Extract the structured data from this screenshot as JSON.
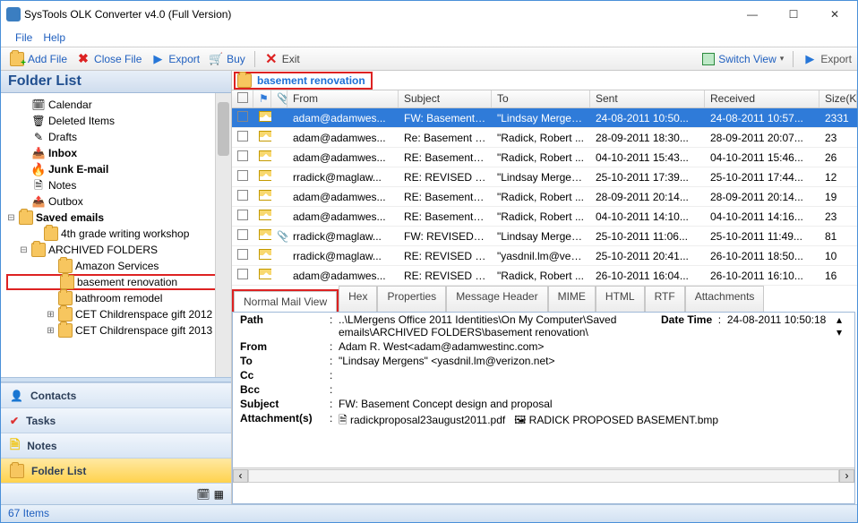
{
  "title": {
    "text": "SysTools OLK Converter v4.0 (Full Version)"
  },
  "winbuttons": {
    "minimize": "—",
    "maximize": "☐",
    "close": "✕"
  },
  "menubar": {
    "file": "File",
    "help": "Help"
  },
  "toolbar": {
    "add_file": "Add File",
    "close_file": "Close File",
    "export": "Export",
    "buy": "Buy",
    "exit": "Exit",
    "switch_view": "Switch View",
    "export2": "Export"
  },
  "left": {
    "header": "Folder List",
    "items": [
      {
        "label": "Calendar",
        "ind": 1,
        "icon": "cal"
      },
      {
        "label": "Deleted Items",
        "ind": 1,
        "icon": "trash"
      },
      {
        "label": "Drafts",
        "ind": 1,
        "icon": "draft"
      },
      {
        "label": "Inbox",
        "ind": 1,
        "icon": "inbox",
        "bold": true
      },
      {
        "label": "Junk E-mail",
        "ind": 1,
        "icon": "junk",
        "bold": true
      },
      {
        "label": "Notes",
        "ind": 1,
        "icon": "note"
      },
      {
        "label": "Outbox",
        "ind": 1,
        "icon": "out"
      },
      {
        "label": "Saved emails",
        "ind": 0,
        "icon": "folder",
        "bold": true,
        "exp": "−"
      },
      {
        "label": "4th grade writing workshop",
        "ind": 2,
        "icon": "folder"
      },
      {
        "label": "ARCHIVED FOLDERS",
        "ind": 1,
        "icon": "folder",
        "exp": "−"
      },
      {
        "label": "Amazon Services",
        "ind": 3,
        "icon": "folder"
      },
      {
        "label": "basement renovation",
        "ind": 3,
        "icon": "folder",
        "selected": true
      },
      {
        "label": "bathroom remodel",
        "ind": 3,
        "icon": "folder"
      },
      {
        "label": "CET Childrenspace gift 2012",
        "ind": 3,
        "icon": "folder",
        "exp": "+"
      },
      {
        "label": "CET Childrenspace gift 2013",
        "ind": 3,
        "icon": "folder",
        "exp": "+"
      }
    ],
    "nav": {
      "contacts": "Contacts",
      "tasks": "Tasks",
      "notes": "Notes",
      "folder": "Folder List"
    }
  },
  "right": {
    "heading": "basement renovation",
    "columns": {
      "from": "From",
      "subject": "Subject",
      "to": "To",
      "sent": "Sent",
      "received": "Received",
      "size": "Size(KB)"
    },
    "rows": [
      {
        "sel": true,
        "clip": false,
        "from": "adam@adamwes...",
        "subject": "FW: Basement C...",
        "to": "\"Lindsay Mergen...",
        "sent": "24-08-2011 10:50...",
        "received": "24-08-2011 10:57...",
        "size": "2331"
      },
      {
        "from": "adam@adamwes...",
        "subject": "Re: Basement Co...",
        "to": "\"Radick, Robert ...",
        "sent": "28-09-2011 18:30...",
        "received": "28-09-2011 20:07...",
        "size": "23"
      },
      {
        "from": "adam@adamwes...",
        "subject": "RE: Basement Co...",
        "to": "\"Radick, Robert ...",
        "sent": "04-10-2011 15:43...",
        "received": "04-10-2011 15:46...",
        "size": "26"
      },
      {
        "from": "rradick@maglaw...",
        "subject": "RE: REVISED PR...",
        "to": "\"Lindsay Mergen...",
        "sent": "25-10-2011 17:39...",
        "received": "25-10-2011 17:44...",
        "size": "12"
      },
      {
        "from": "adam@adamwes...",
        "subject": "RE: Basement Co...",
        "to": "\"Radick, Robert ...",
        "sent": "28-09-2011 20:14...",
        "received": "28-09-2011 20:14...",
        "size": "19"
      },
      {
        "from": "adam@adamwes...",
        "subject": "RE: Basement Co...",
        "to": "\"Radick, Robert ...",
        "sent": "04-10-2011 14:10...",
        "received": "04-10-2011 14:16...",
        "size": "23"
      },
      {
        "clip": true,
        "from": "rradick@maglaw...",
        "subject": "FW: REVISED PR...",
        "to": "\"Lindsay Mergen...",
        "sent": "25-10-2011 11:06...",
        "received": "25-10-2011 11:49...",
        "size": "81"
      },
      {
        "from": "rradick@maglaw...",
        "subject": "RE: REVISED PR...",
        "to": "\"yasdnil.lm@veri...",
        "sent": "25-10-2011 20:41...",
        "received": "26-10-2011 18:50...",
        "size": "10"
      },
      {
        "from": "adam@adamwes...",
        "subject": "RE: REVISED PR...",
        "to": "\"Radick, Robert ...",
        "sent": "26-10-2011 16:04...",
        "received": "26-10-2011 16:10...",
        "size": "16"
      }
    ],
    "tabs": {
      "normal": "Normal Mail View",
      "hex": "Hex",
      "props": "Properties",
      "msghdr": "Message Header",
      "mime": "MIME",
      "html": "HTML",
      "rtf": "RTF",
      "attach": "Attachments"
    },
    "preview": {
      "labels": {
        "path": "Path",
        "from": "From",
        "to": "To",
        "cc": "Cc",
        "bcc": "Bcc",
        "subject": "Subject",
        "attachments": "Attachment(s)",
        "datetime": "Date Time"
      },
      "path": "..\\LMergens  Office 2011 Identities\\On My Computer\\Saved emails\\ARCHIVED FOLDERS\\basement renovation\\",
      "from": "Adam R. West<adam@adamwestinc.com>",
      "to": "\"Lindsay Mergens\" <yasdnil.lm@verizon.net>",
      "cc": "",
      "bcc": "",
      "subject": "FW: Basement Concept design and proposal",
      "datetime": "24-08-2011 10:50:18",
      "att1": "radickproposal23august2011.pdf",
      "att2": "RADICK PROPOSED BASEMENT.bmp"
    }
  },
  "status": {
    "text": "67 Items"
  }
}
